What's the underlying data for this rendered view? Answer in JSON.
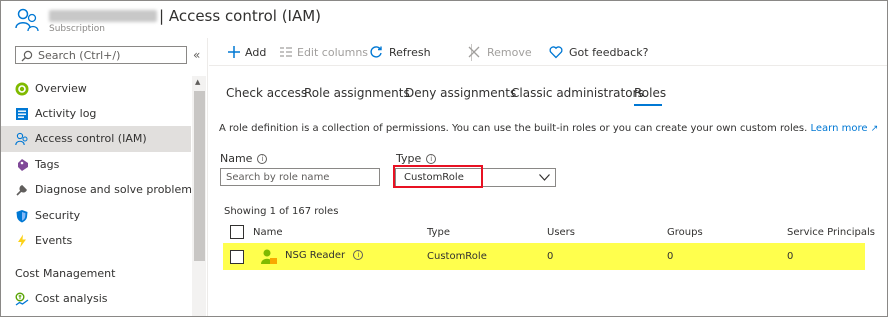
{
  "header": {
    "title": "| Access control (IAM)",
    "subtitle": "Subscription"
  },
  "sidebar": {
    "search_placeholder": "Search (Ctrl+/)",
    "collapse_label": "«",
    "items": [
      {
        "label": "Overview",
        "icon": "overview-icon"
      },
      {
        "label": "Activity log",
        "icon": "activity-log-icon"
      },
      {
        "label": "Access control (IAM)",
        "icon": "iam-icon",
        "active": true
      },
      {
        "label": "Tags",
        "icon": "tag-icon"
      },
      {
        "label": "Diagnose and solve problems",
        "icon": "wrench-icon"
      },
      {
        "label": "Security",
        "icon": "shield-icon"
      },
      {
        "label": "Events",
        "icon": "lightning-icon"
      }
    ],
    "section_header": "Cost Management",
    "section_items": [
      {
        "label": "Cost analysis",
        "icon": "cost-analysis-icon"
      }
    ]
  },
  "toolbar": {
    "add": "Add",
    "edit_columns": "Edit columns",
    "refresh": "Refresh",
    "remove": "Remove",
    "feedback": "Got feedback?"
  },
  "tabs": [
    "Check access",
    "Role assignments",
    "Deny assignments",
    "Classic administrators",
    "Roles"
  ],
  "active_tab": "Roles",
  "description": {
    "text": "A role definition is a collection of permissions. You can use the built-in roles or you can create your own custom roles.",
    "link": "Learn more"
  },
  "filters": {
    "name_label": "Name",
    "name_placeholder": "Search by role name",
    "type_label": "Type",
    "type_value": "CustomRole"
  },
  "results": {
    "showing": "Showing 1 of 167 roles",
    "columns": [
      "Name",
      "Type",
      "Users",
      "Groups",
      "Service Principals"
    ],
    "rows": [
      {
        "name": "NSG Reader",
        "type": "CustomRole",
        "users": "0",
        "groups": "0",
        "service_principals": "0"
      }
    ]
  },
  "colors": {
    "accent": "#0078d4",
    "highlight": "#ffff4d",
    "annotation_border": "#e81123"
  }
}
